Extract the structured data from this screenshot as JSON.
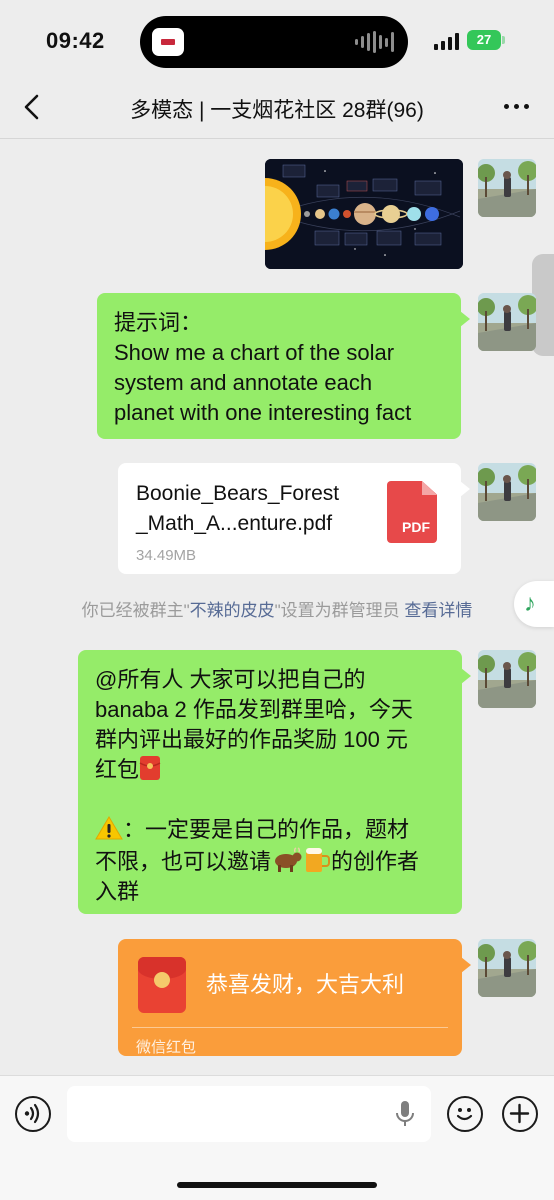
{
  "status": {
    "time": "09:42",
    "battery": "27"
  },
  "nav": {
    "title": "多模态 | 一支烟花社区 28群(96)"
  },
  "messages": {
    "prompt_lines": [
      "提示词：",
      "Show me a chart of the solar",
      "system and annotate each",
      "planet with one interesting fact"
    ],
    "file": {
      "name_line1": "Boonie_Bears_Forest",
      "name_line2": "_Math_A...enture.pdf",
      "size": "34.49MB",
      "type_label": "PDF"
    },
    "notice": {
      "prefix": "你已经被群主\"",
      "name": "不辣的皮皮",
      "suffix": "\"设置为群管理员 ",
      "link": "查看详情"
    },
    "announcement": {
      "line1": "@所有人 大家可以把自己的",
      "line2": "banaba 2 作品发到群里哈，今天",
      "line3": "群内评出最好的作品奖励 100 元",
      "line4": "红包",
      "line5": "：一定要是自己的作品，题材",
      "line6": "不限，也可以邀请",
      "line6b": "的创作者",
      "line7": "入群"
    },
    "red_packet": {
      "title": "恭喜发财，大吉大利",
      "footer": "微信红包"
    }
  },
  "icons": {
    "back": "chevron-left-icon",
    "more": "more-dots-icon",
    "voice": "voice-icon",
    "mic": "microphone-icon",
    "emoji": "emoji-icon",
    "add": "plus-icon",
    "music": "music-note-icon"
  },
  "colors": {
    "green_bubble": "#95ec69",
    "red_packet": "#fa9d3b",
    "link": "#576b95",
    "background": "#ededed"
  }
}
